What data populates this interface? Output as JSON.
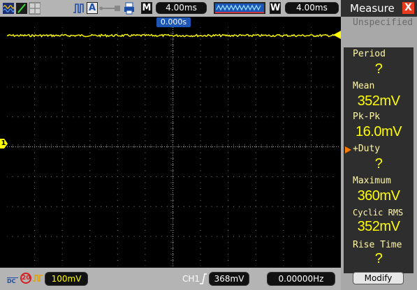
{
  "topbar": {
    "time_div": "4.00ms",
    "window_time": "4.00ms",
    "timebase_label": "M",
    "window_label": "W",
    "mode_label": "A"
  },
  "trigger": {
    "position_label": "0.000s"
  },
  "channel": {
    "marker": "1",
    "coupling": "DC",
    "bw_limit": "20",
    "volts_div": "100mV"
  },
  "bottombar": {
    "trigger_source": "CH1",
    "trigger_level": "368mV",
    "frequency": "0.00000Hz"
  },
  "measure_panel": {
    "title": "Measure",
    "close": "X",
    "subtitle": "Unspecified",
    "items": [
      {
        "label": "Period",
        "value": "?"
      },
      {
        "label": "Mean",
        "value": "352mV"
      },
      {
        "label": "Pk-Pk",
        "value": "16.0mV"
      },
      {
        "label": "+Duty",
        "value": "?"
      },
      {
        "label": "Maximum",
        "value": "360mV"
      },
      {
        "label": "Cyclic RMS",
        "value": "352mV"
      },
      {
        "label": "Rise Time",
        "value": "?"
      }
    ],
    "modify_button": "Modify"
  },
  "colors": {
    "trace": "#ffff00",
    "panel_bg": "#a8a8a8",
    "timebase_blue": "#1c57b8",
    "close_red": "#e83a1c"
  }
}
